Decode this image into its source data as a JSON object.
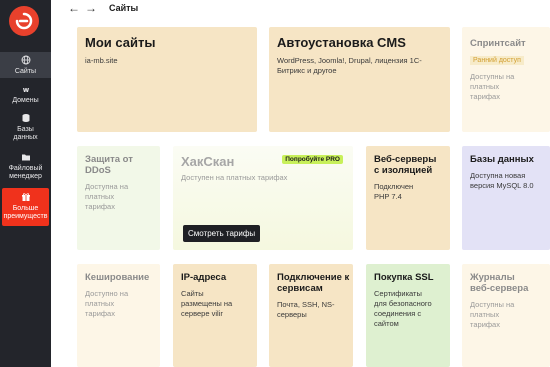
{
  "header": {
    "title": "Сайты",
    "back_icon": "arrow-left-icon",
    "forward_icon": "arrow-right-icon"
  },
  "sidebar": {
    "items": [
      {
        "label": "Сайты",
        "icon": "globe-icon"
      },
      {
        "label": "Домены",
        "icon": "www-icon"
      },
      {
        "label": "Базы данных",
        "icon": "database-icon"
      },
      {
        "label": "Файловый менеджер",
        "icon": "folder-icon"
      },
      {
        "label": "Больше преимуществ",
        "icon": "gift-icon"
      }
    ],
    "promo_color": "#f0321c"
  },
  "cards": {
    "my_sites": {
      "title": "Мои сайты",
      "sub": "ia-mb.site"
    },
    "autoinstall": {
      "title": "Автоустановка CMS",
      "sub": "WordPress, Joomla!, Drupal, лицензия 1С-Битрикс и другое"
    },
    "sprint": {
      "title": "Спринтсайт",
      "badge": "Ранний доступ",
      "sub": "Доступны на платных тарифах"
    },
    "ddos": {
      "title": "Защита от DDoS",
      "sub": "Доступна на платных тарифах"
    },
    "haxscan": {
      "title": "ХакСкан",
      "badge": "Попробуйте PRO",
      "sub": "Доступен на платных тарифах",
      "button": "Смотреть тарифы"
    },
    "isolated": {
      "title": "Веб-серверы с изоляцией",
      "sub": "Подключен PHP 7.4"
    },
    "databases": {
      "title": "Базы данных",
      "sub": "Доступна новая версия MySQL 8.0"
    },
    "caching": {
      "title": "Кеширование",
      "sub": "Доступно на платных тарифах"
    },
    "ips": {
      "title": "IP-адреса",
      "sub": "Сайты размещены на сервере vilir"
    },
    "services": {
      "title": "Подключение к сервисам",
      "sub": "Почта, SSH, NS-серверы"
    },
    "ssl": {
      "title": "Покупка SSL",
      "sub": "Сертификаты для безопасного соединения с сайтом"
    },
    "logs": {
      "title": "Журналы веб-сервера",
      "sub": "Доступны на платных тарифах"
    }
  }
}
